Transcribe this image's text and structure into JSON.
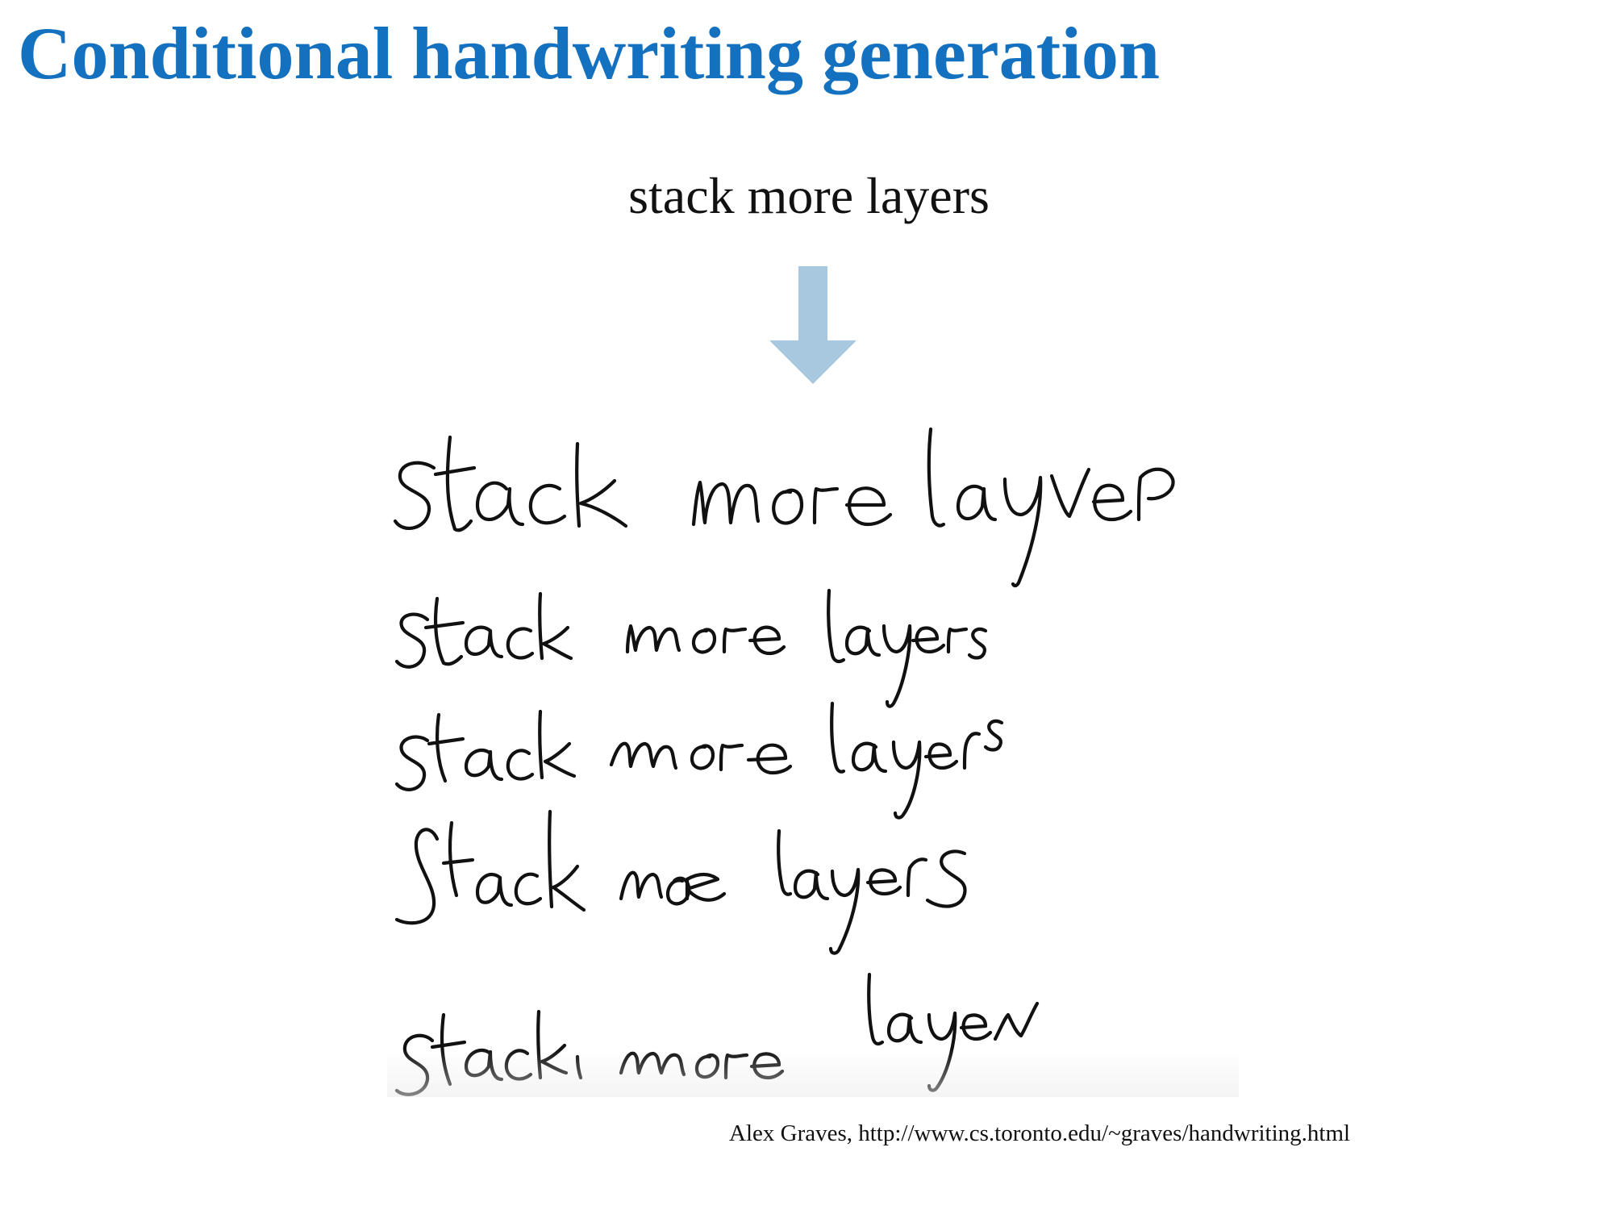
{
  "slide": {
    "title": "Conditional handwriting generation",
    "input_text": "stack more layers",
    "arrow_icon": "down-arrow-icon",
    "arrow_color": "#a8c8e0",
    "title_color": "#1471bf",
    "citation": "Alex Graves, http://www.cs.toronto.edu/~graves/handwriting.html"
  },
  "handwriting_samples": {
    "description_icon": "handwriting-image",
    "lines": [
      "stack more layer",
      "stack more layers",
      "stack more layers",
      "stack more layers",
      "stack more layers"
    ]
  }
}
